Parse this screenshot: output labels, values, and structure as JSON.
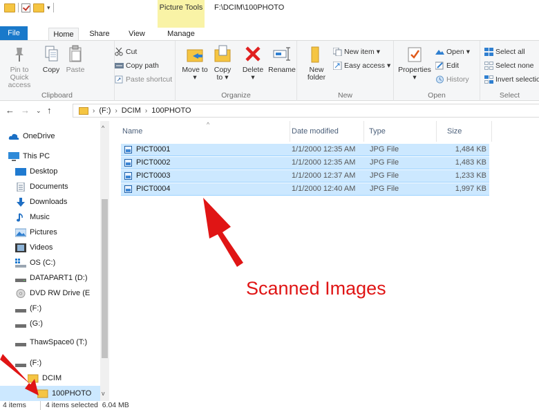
{
  "window": {
    "contextual_tab_group": "Picture Tools",
    "title_path": "F:\\DCIM\\100PHOTO"
  },
  "tabs": [
    {
      "label": "File"
    },
    {
      "label": "Home"
    },
    {
      "label": "Share"
    },
    {
      "label": "View"
    },
    {
      "label": "Manage"
    }
  ],
  "ribbon": {
    "clipboard": {
      "group_label": "Clipboard",
      "pin": "Pin to Quick access",
      "copy": "Copy",
      "paste": "Paste",
      "cut": "Cut",
      "copy_path": "Copy path",
      "paste_shortcut": "Paste shortcut"
    },
    "organize": {
      "group_label": "Organize",
      "move_to": "Move to",
      "copy_to": "Copy to",
      "delete": "Delete",
      "rename": "Rename"
    },
    "new": {
      "group_label": "New",
      "new_folder": "New folder",
      "new_item": "New item",
      "easy_access": "Easy access"
    },
    "open": {
      "group_label": "Open",
      "properties": "Properties",
      "open": "Open",
      "edit": "Edit",
      "history": "History"
    },
    "select": {
      "group_label": "Select",
      "select_all": "Select all",
      "select_none": "Select none",
      "invert_selection": "Invert selection"
    }
  },
  "address": {
    "crumbs": [
      "(F:)",
      "DCIM",
      "100PHOTO"
    ]
  },
  "nav": {
    "items": [
      {
        "label": "OneDrive",
        "icon": "cloud-icon"
      },
      {
        "label": "This PC",
        "icon": "computer-icon"
      },
      {
        "label": "Desktop",
        "icon": "desktop-icon"
      },
      {
        "label": "Documents",
        "icon": "documents-icon"
      },
      {
        "label": "Downloads",
        "icon": "download-icon"
      },
      {
        "label": "Music",
        "icon": "music-icon"
      },
      {
        "label": "Pictures",
        "icon": "pictures-icon"
      },
      {
        "label": "Videos",
        "icon": "videos-icon"
      },
      {
        "label": "OS (C:)",
        "icon": "windows-drive-icon"
      },
      {
        "label": "DATAPART1 (D:)",
        "icon": "drive-icon"
      },
      {
        "label": "DVD RW Drive (E",
        "icon": "dvd-icon"
      },
      {
        "label": "(F:)",
        "icon": "drive-icon"
      },
      {
        "label": "(G:)",
        "icon": "drive-icon"
      },
      {
        "label": "ThawSpace0 (T:)",
        "icon": "drive-icon"
      },
      {
        "label": "(F:)",
        "icon": "drive-icon"
      },
      {
        "label": "DCIM",
        "icon": "folder-icon"
      },
      {
        "label": "100PHOTO",
        "icon": "folder-icon"
      }
    ]
  },
  "files": {
    "columns": [
      "Name",
      "Date modified",
      "Type",
      "Size"
    ],
    "rows": [
      {
        "name": "PICT0001",
        "date": "1/1/2000 12:35 AM",
        "type": "JPG File",
        "size": "1,484 KB"
      },
      {
        "name": "PICT0002",
        "date": "1/1/2000 12:35 AM",
        "type": "JPG File",
        "size": "1,483 KB"
      },
      {
        "name": "PICT0003",
        "date": "1/1/2000 12:37 AM",
        "type": "JPG File",
        "size": "1,233 KB"
      },
      {
        "name": "PICT0004",
        "date": "1/1/2000 12:40 AM",
        "type": "JPG File",
        "size": "1,997 KB"
      }
    ]
  },
  "status": {
    "items_count": "4 items",
    "selected": "4 items selected  6.04 MB"
  },
  "annotation": {
    "text": "Scanned Images",
    "color": "#e01515"
  },
  "colors": {
    "file_tab": "#1979ca",
    "selection": "#cce8ff",
    "contextual_tab": "#f9f3a6"
  }
}
